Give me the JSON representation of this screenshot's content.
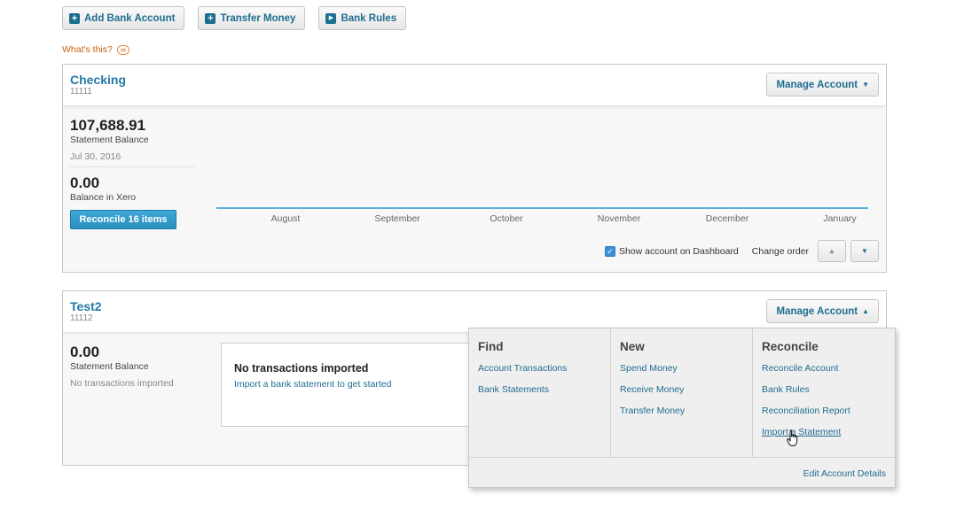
{
  "toolbar": {
    "add_bank_account": "Add Bank Account",
    "transfer_money": "Transfer Money",
    "bank_rules": "Bank Rules",
    "plus_icon_glyph": "+",
    "arrow_icon_glyph": "▶"
  },
  "whats_this": "What's this?",
  "accounts": [
    {
      "name": "Checking",
      "number": "11111",
      "manage_label": "Manage Account",
      "statement_balance": "107,688.91",
      "statement_balance_label": "Statement Balance",
      "statement_date": "Jul 30, 2016",
      "xero_balance": "0.00",
      "xero_balance_label": "Balance in Xero",
      "reconcile_label": "Reconcile 16 items",
      "months": [
        "August",
        "September",
        "October",
        "November",
        "December",
        "January"
      ],
      "show_on_dashboard": "Show account on Dashboard",
      "show_on_dashboard_checked": true,
      "change_order": "Change order"
    },
    {
      "name": "Test2",
      "number": "11112",
      "manage_label": "Manage Account",
      "statement_balance": "0.00",
      "statement_balance_label": "Statement Balance",
      "status": "No transactions imported",
      "empty_title": "No transactions imported",
      "empty_link": "Import a bank statement to get started"
    }
  ],
  "manage_menu": {
    "columns": [
      {
        "heading": "Find",
        "links": [
          "Account Transactions",
          "Bank Statements"
        ]
      },
      {
        "heading": "New",
        "links": [
          "Spend Money",
          "Receive Money",
          "Transfer Money"
        ]
      },
      {
        "heading": "Reconcile",
        "links": [
          "Reconcile Account",
          "Bank Rules",
          "Reconciliation Report",
          "Import a Statement"
        ]
      }
    ],
    "footer_link": "Edit Account Details"
  },
  "colors": {
    "link": "#1f6d8f",
    "account_name": "#2478a5",
    "reconcile_button": "#2a8fbf",
    "whats_this": "#c65f10",
    "chart_line": "#59b1d9"
  }
}
